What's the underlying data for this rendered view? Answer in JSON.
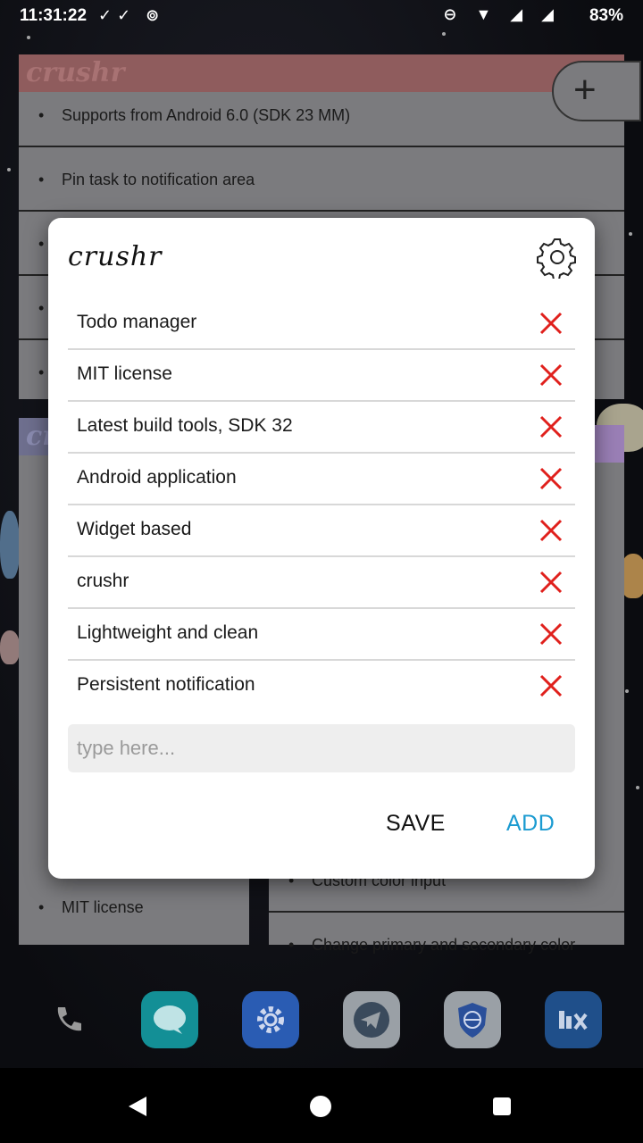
{
  "status_bar": {
    "time": "11:31:22",
    "left_icons": "✓✓ ⊚",
    "right_icons": "⊖ ▼ ◢ ◢",
    "battery": "83%"
  },
  "background_widgets": {
    "top": {
      "title": "crushr",
      "items": [
        "Supports from Android 6.0 (SDK 23 MM)",
        "Pin task to notification area"
      ]
    },
    "bottom_left": {
      "items": [
        "MIT license"
      ]
    },
    "bottom_right": {
      "items": [
        "Custom color input",
        "Change primary and secondary color"
      ]
    },
    "fab_label": "+"
  },
  "dialog": {
    "title": "crushr",
    "tasks": [
      "Todo manager",
      "MIT license",
      "Latest build tools, SDK 32",
      "Android application",
      "Widget based",
      "crushr",
      "Lightweight and clean",
      "Persistent notification"
    ],
    "input_placeholder": "type here...",
    "save_label": "SAVE",
    "add_label": "ADD"
  },
  "dock": [
    "phone-icon",
    "messages-icon",
    "settings-icon",
    "telegram-icon",
    "browser-icon",
    "mix-icon"
  ],
  "colors": {
    "accent": "#1b9bd1",
    "delete": "#e0201c",
    "widget_header": "#8f5c5d"
  }
}
